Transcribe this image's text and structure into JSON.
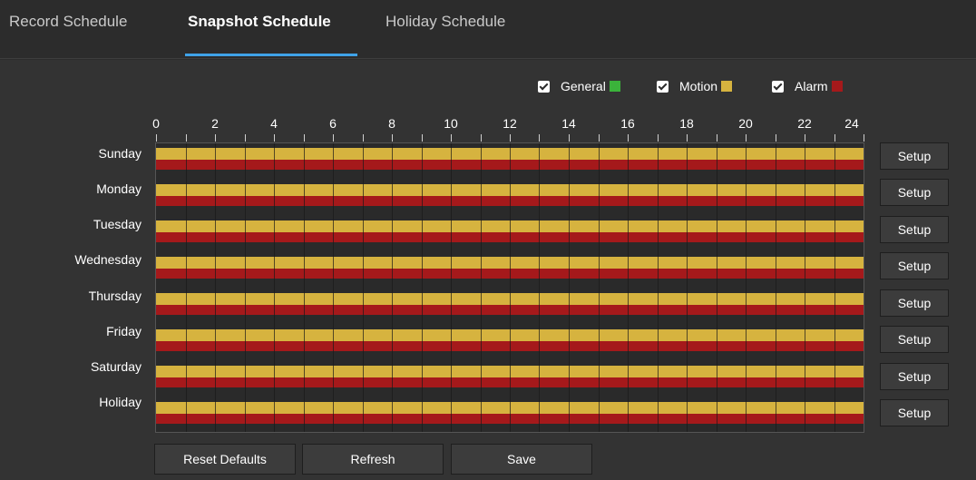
{
  "tabs": [
    {
      "label": "Record Schedule",
      "active": false
    },
    {
      "label": "Snapshot Schedule",
      "active": true
    },
    {
      "label": "Holiday Schedule",
      "active": false
    }
  ],
  "legend": [
    {
      "label": "General",
      "checked": true,
      "color": "#3bb33b"
    },
    {
      "label": "Motion",
      "checked": true,
      "color": "#d6b33f"
    },
    {
      "label": "Alarm",
      "checked": true,
      "color": "#a5191b"
    }
  ],
  "hours": [
    "0",
    "2",
    "4",
    "6",
    "8",
    "10",
    "12",
    "14",
    "16",
    "18",
    "20",
    "22",
    "24"
  ],
  "days": [
    {
      "label": "Sunday",
      "motion": [
        0,
        24
      ],
      "alarm": [
        0,
        24
      ]
    },
    {
      "label": "Monday",
      "motion": [
        0,
        24
      ],
      "alarm": [
        0,
        24
      ]
    },
    {
      "label": "Tuesday",
      "motion": [
        0,
        24
      ],
      "alarm": [
        0,
        24
      ]
    },
    {
      "label": "Wednesday",
      "motion": [
        0,
        24
      ],
      "alarm": [
        0,
        24
      ]
    },
    {
      "label": "Thursday",
      "motion": [
        0,
        24
      ],
      "alarm": [
        0,
        24
      ]
    },
    {
      "label": "Friday",
      "motion": [
        0,
        24
      ],
      "alarm": [
        0,
        24
      ]
    },
    {
      "label": "Saturday",
      "motion": [
        0,
        24
      ],
      "alarm": [
        0,
        24
      ]
    },
    {
      "label": "Holiday",
      "motion": [
        0,
        24
      ],
      "alarm": [
        0,
        24
      ]
    }
  ],
  "setup_label": "Setup",
  "footer": {
    "reset_label": "Reset Defaults",
    "refresh_label": "Refresh",
    "save_label": "Save"
  }
}
